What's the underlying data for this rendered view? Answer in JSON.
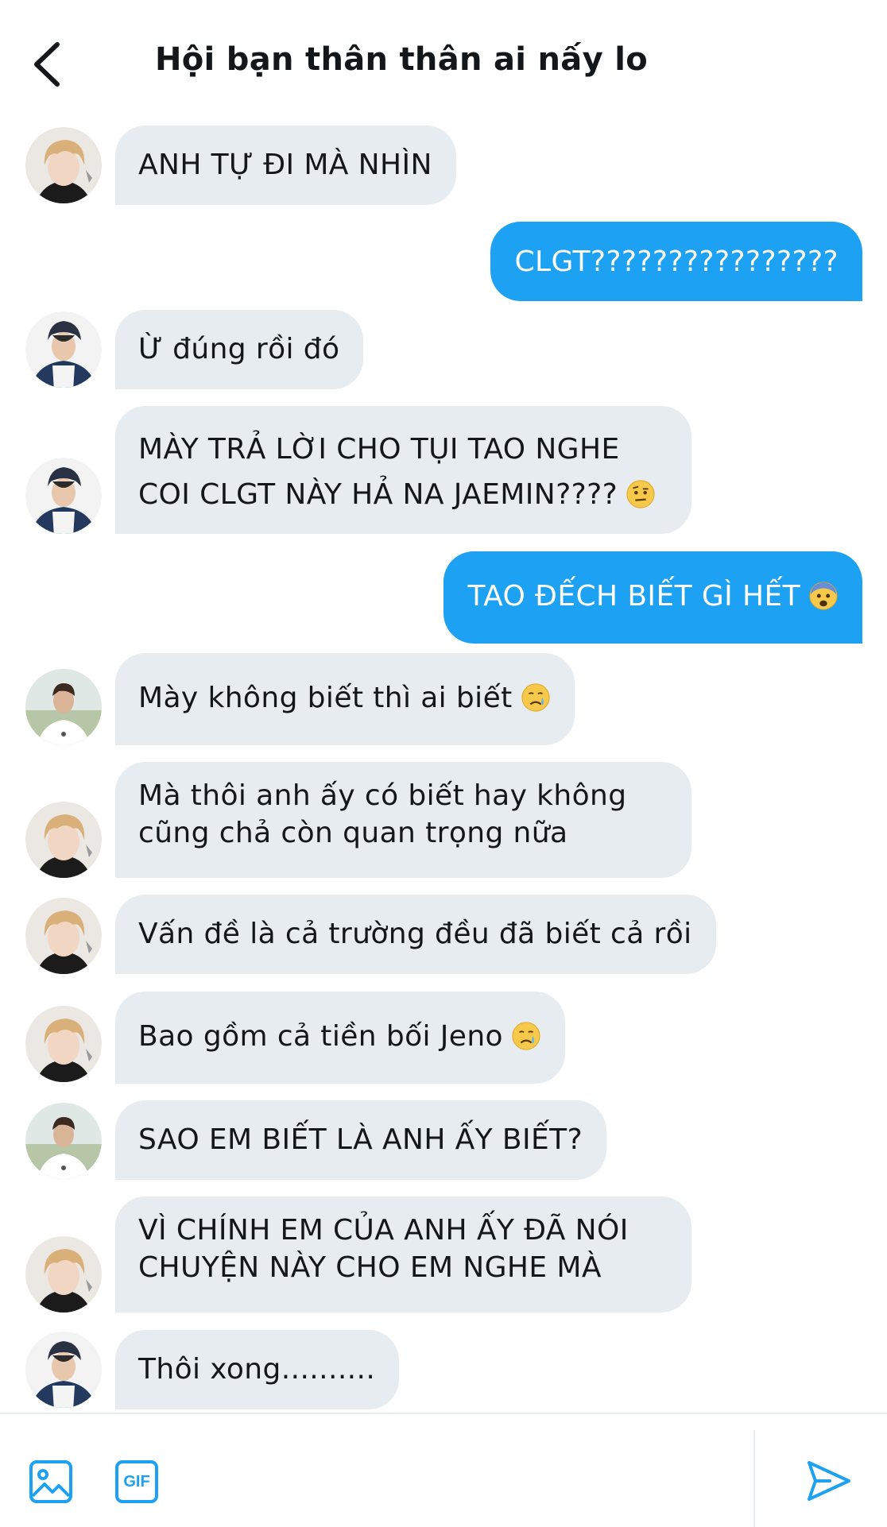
{
  "header": {
    "title": "Hội bạn thân thân ai nấy lo",
    "back_icon": "chevron-left-icon"
  },
  "colors": {
    "accent": "#1da1f2",
    "received_bubble": "#e6ecf0",
    "text": "#14171a"
  },
  "messages": [
    {
      "from": "member-1",
      "text": "ANH TỰ ĐI MÀ NHÌN"
    },
    {
      "from": "me",
      "text": "CLGT????????????????"
    },
    {
      "from": "member-2",
      "text": "Ừ đúng rồi đó"
    },
    {
      "from": "member-2",
      "line1": "MÀY TRẢ LỜI CHO TỤI TAO NGHE",
      "line2": "COI CLGT NÀY HẢ NA JAEMIN????",
      "emoji": "raised-eyebrow-face"
    },
    {
      "from": "me",
      "text": "TAO ĐẾCH BIẾT GÌ HẾT",
      "emoji": "fearful-face"
    },
    {
      "from": "member-3",
      "text": "Mày không biết thì ai biết",
      "emoji": "crying-face"
    },
    {
      "from": "member-1",
      "line1": "Mà thôi anh ấy có biết hay không",
      "line2": "cũng chả còn quan trọng nữa"
    },
    {
      "from": "member-1",
      "text": "Vấn đề là cả trường đều đã biết cả rồi"
    },
    {
      "from": "member-1",
      "text": "Bao gồm cả tiền bối Jeno",
      "emoji": "crying-face"
    },
    {
      "from": "member-3",
      "text": "SAO EM BIẾT LÀ ANH ẤY BIẾT?"
    },
    {
      "from": "member-1",
      "line1": "VÌ CHÍNH EM CỦA ANH ẤY ĐÃ NÓI",
      "line2": "CHUYỆN NÀY CHO EM NGHE MÀ"
    },
    {
      "from": "member-2",
      "text": "Thôi xong.........."
    }
  ],
  "composer": {
    "image_icon": "image-icon",
    "gif_label": "GIF",
    "send_icon": "send-icon"
  }
}
